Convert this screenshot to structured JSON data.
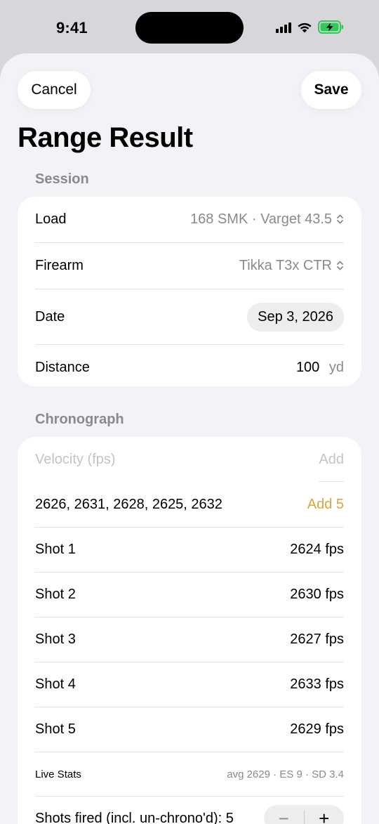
{
  "status": {
    "time": "9:41"
  },
  "nav": {
    "cancel_label": "Cancel",
    "save_label": "Save",
    "title": "Range Result"
  },
  "session": {
    "header": "Session",
    "load_label": "Load",
    "load_value": "168 SMK · Varget 43.5",
    "firearm_label": "Firearm",
    "firearm_value": "Tikka T3x CTR",
    "date_label": "Date",
    "date_value": "Sep 3, 2026",
    "distance_label": "Distance",
    "distance_value": "100",
    "distance_unit": "yd"
  },
  "chronograph": {
    "header": "Chronograph",
    "velocity_placeholder": "Velocity (fps)",
    "add_label": "Add",
    "quick_values": "2626, 2631, 2628, 2625, 2632",
    "add5_label": "Add 5",
    "shots": [
      {
        "label": "Shot 1",
        "value": "2624 fps"
      },
      {
        "label": "Shot 2",
        "value": "2630 fps"
      },
      {
        "label": "Shot 3",
        "value": "2627 fps"
      },
      {
        "label": "Shot 4",
        "value": "2633 fps"
      },
      {
        "label": "Shot 5",
        "value": "2629 fps"
      }
    ],
    "live_stats_label": "Live Stats",
    "live_stats_value": "avg 2629 · ES 9 · SD 3.4",
    "shots_fired_label": "Shots fired (incl. un-chrono'd): 5",
    "stepper_minus": "−",
    "stepper_plus": "+"
  },
  "colors": {
    "accent": "#d9a640",
    "background": "#f2f2f7",
    "battery": "#34c759"
  }
}
